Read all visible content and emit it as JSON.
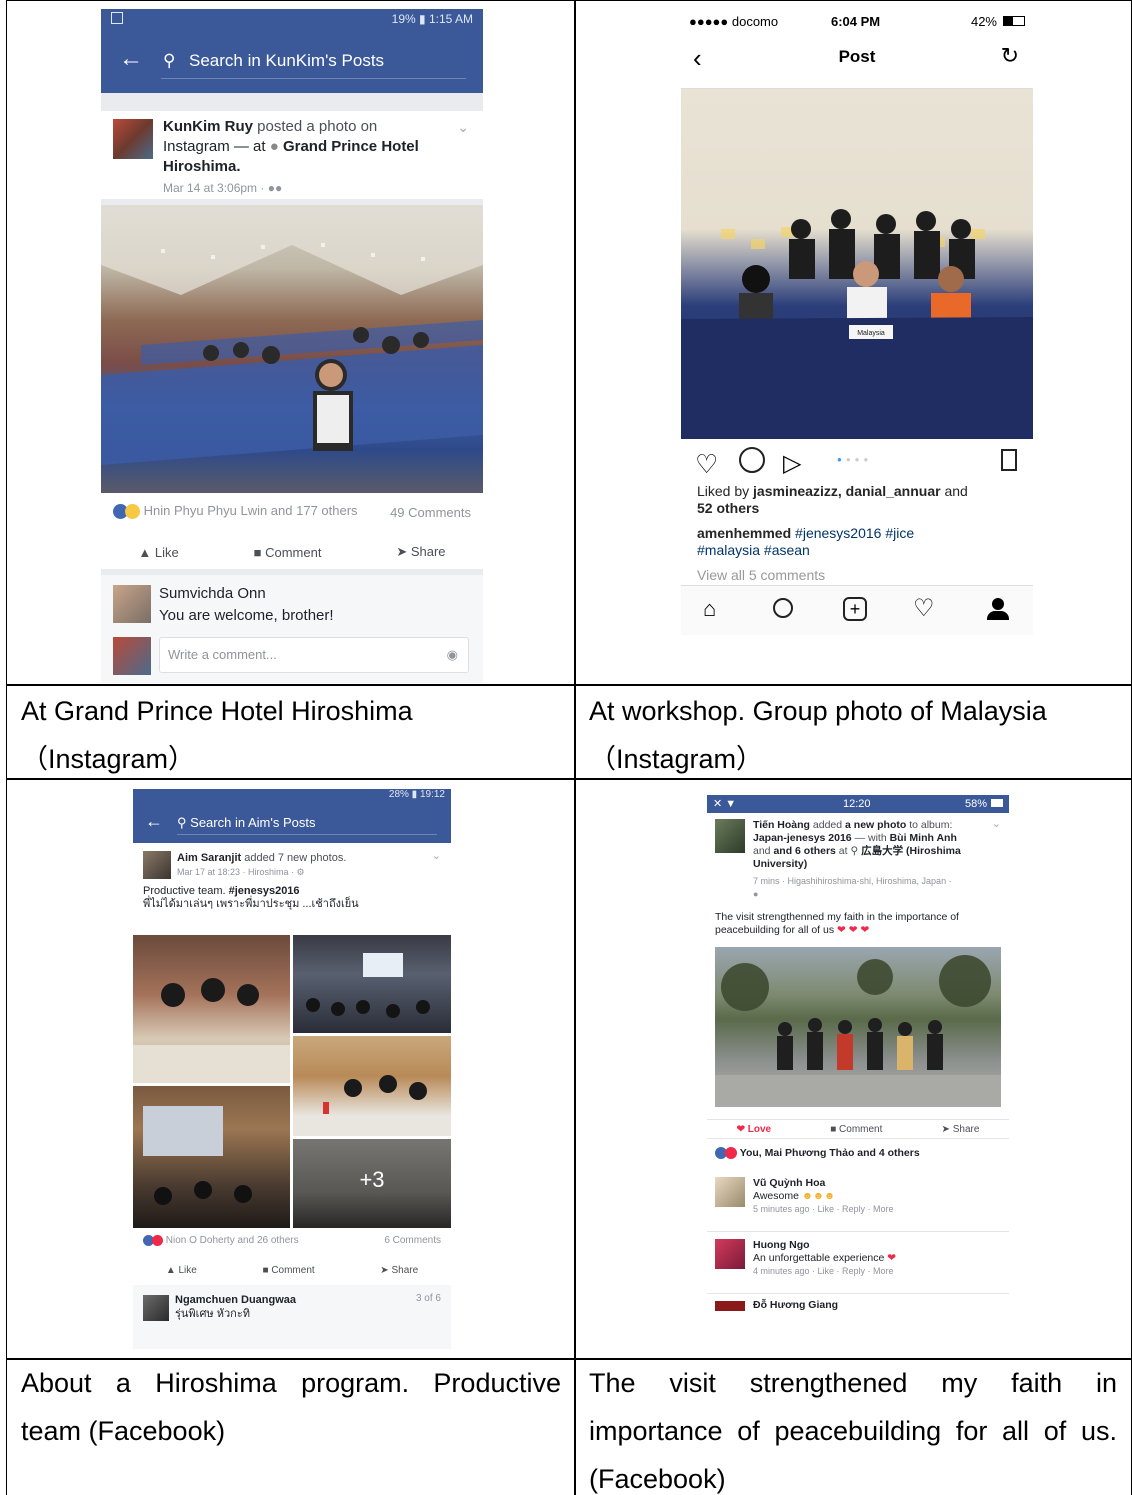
{
  "captions": {
    "fb1": "At Grand Prince Hotel Hiroshima\n（Instagram）",
    "ig": "At workshop. Group photo of Malaysia\n（Instagram）",
    "fb3_line1": "About a Hiroshima program. Productive",
    "fb3_line2": "team (Facebook)",
    "fb4_line1": "The visit strengthened my faith in",
    "fb4_line2": "importance of peacebuilding for all of us.",
    "fb4_line3": "(Facebook)"
  },
  "fb1": {
    "status_right": "19% ▮ 1:15 AM",
    "search_placeholder": "Search in KunKim's Posts",
    "author": "KunKim Ruy",
    "posted_text": " posted a photo on",
    "line2_prefix": "Instagram — at ",
    "place": "Grand Prince Hotel Hiroshima.",
    "time": "Mar 14 at 3:06pm · ",
    "reactions": "Hnin Phyu Phyu Lwin and 177 others",
    "comments_count": "49 Comments",
    "like": "Like",
    "comment": "Comment",
    "share": "Share",
    "commenter": "Sumvichda Onn",
    "comment_text": "You are welcome, brother!",
    "write_placeholder": "Write a comment..."
  },
  "ig": {
    "carrier": "●●●●● docomo",
    "time": "6:04 PM",
    "battery": "42%",
    "title": "Post",
    "liked_prefix": "Liked by ",
    "liked_users": "jasmineazizz, danial_annuar",
    "liked_and": " and",
    "liked_count": "52 others",
    "caption_user": "amenhemmed",
    "caption_tags_1": " #jenesys2016 #jice",
    "caption_tags_2": "#malaysia #asean",
    "view_comments": "View all 5 comments",
    "placard": "Malaysia"
  },
  "fb3": {
    "status": "28% ▮ 19:12",
    "search_placeholder": "Search in Aim's Posts",
    "author": "Aim Saranjit",
    "added": " added 7 new photos.",
    "time": "Mar 17 at 18:23 · Hiroshima · ",
    "text1_plain": "Productive team. ",
    "text1_tag": "#jenesys2016",
    "text2": "พี่ไม่ได้มาเล่นๆ เพราะพี่มาประชุม ...เช้าถึงเย็น",
    "more_photos": "+3",
    "reactions": "Nion O Doherty and 26 others",
    "comments_count": "6 Comments",
    "like": "Like",
    "comment": "Comment",
    "share": "Share",
    "commenter": "Ngamchuen Duangwaa",
    "comment_count_label": "3 of 6",
    "comment_text": "รุ่นพิเศษ หัวกะทิ"
  },
  "fb4": {
    "time": "12:20",
    "battery": "58%",
    "author": "Tiến Hoàng",
    "added": " added ",
    "new_photo": "a new photo",
    "to_album": " to album:",
    "album": "Japan-jenesys 2016",
    "with": " — with ",
    "with_name": "Bùi Minh Anh",
    "and_others": "and 6 others",
    "at": " at ",
    "place": "広島大学 (Hiroshima University)",
    "meta": "7 mins · Higashihiroshima-shi, Hiroshima, Japan ·",
    "post_text": "The visit strengthenned my faith in the importance of peacebuilding for all of us",
    "love": "Love",
    "comment": "Comment",
    "share": "Share",
    "reactions": "You, Mai Phương Thảo and 4 others",
    "c1_name": "Vũ Quỳnh Hoa",
    "c1_text": "Awesome",
    "c1_meta": "5 minutes ago · Like · Reply · More",
    "c2_name": "Huong Ngo",
    "c2_text": "An unforgettable experience",
    "c2_meta": "4 minutes ago · Like · Reply · More",
    "c3_name": "Đỗ Hương Giang"
  },
  "colors": {
    "facebook_blue": "#3b5998",
    "link_blue": "#365899",
    "love_red": "#f0284a",
    "ig_link": "#003569"
  }
}
